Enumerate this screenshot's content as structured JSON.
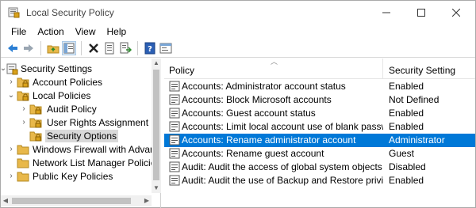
{
  "window": {
    "title": "Local Security Policy",
    "controls": {
      "minimize": "—",
      "maximize": "☐",
      "close": "✕"
    }
  },
  "menu": [
    "File",
    "Action",
    "View",
    "Help"
  ],
  "toolbar": {
    "buttons": [
      "back-icon",
      "forward-icon",
      "up-folder-icon",
      "show-tree-icon",
      "delete-icon",
      "properties-icon",
      "export-icon",
      "help-icon",
      "console-icon"
    ]
  },
  "tree": {
    "items": [
      {
        "label": "Security Settings",
        "expanded": true
      },
      {
        "label": "Account Policies",
        "expanded": false
      },
      {
        "label": "Local Policies",
        "expanded": true
      },
      {
        "label": "Audit Policy",
        "expanded": false
      },
      {
        "label": "User Rights Assignment",
        "expanded": false
      },
      {
        "label": "Security Options",
        "selected": true
      },
      {
        "label": "Windows Firewall with Advanc",
        "expanded": false
      },
      {
        "label": "Network List Manager Policies"
      },
      {
        "label": "Public Key Policies",
        "expanded": false
      }
    ]
  },
  "list": {
    "columns": {
      "policy": "Policy",
      "setting": "Security Setting"
    },
    "rows": [
      {
        "policy": "Accounts: Administrator account status",
        "setting": "Enabled"
      },
      {
        "policy": "Accounts: Block Microsoft accounts",
        "setting": "Not Defined"
      },
      {
        "policy": "Accounts: Guest account status",
        "setting": "Enabled"
      },
      {
        "policy": "Accounts: Limit local account use of blank passwor...",
        "setting": "Enabled"
      },
      {
        "policy": "Accounts: Rename administrator account",
        "setting": "Administrator",
        "selected": true
      },
      {
        "policy": "Accounts: Rename guest account",
        "setting": "Guest"
      },
      {
        "policy": "Audit: Audit the access of global system objects",
        "setting": "Disabled"
      },
      {
        "policy": "Audit: Audit the use of Backup and Restore privilege",
        "setting": "Enabled"
      }
    ]
  },
  "colors": {
    "selection": "#0078d7",
    "tree_selection": "#d9d9d9",
    "folder": "#e8b84a",
    "lock": "#d9a21b"
  }
}
